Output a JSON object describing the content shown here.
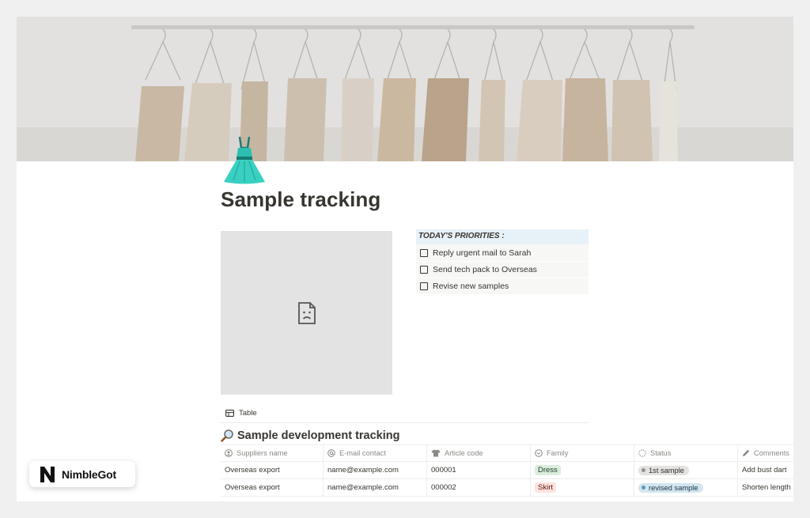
{
  "page": {
    "title": "Sample tracking",
    "icon": "dress-emoji-icon"
  },
  "priorities": {
    "header": "TODAY'S PRIORITIES :",
    "items": [
      {
        "label": "Reply urgent mail to Sarah",
        "checked": false
      },
      {
        "label": "Send tech pack to Overseas",
        "checked": false
      },
      {
        "label": "Revise new samples",
        "checked": false
      }
    ]
  },
  "database": {
    "view_label": "Table",
    "title": "Sample development tracking",
    "title_icon": "magnifier-icon",
    "columns": [
      {
        "label": "Suppliers name",
        "icon": "person-icon"
      },
      {
        "label": "E-mail contact",
        "icon": "at-sign-icon"
      },
      {
        "label": "Article code",
        "icon": "shirt-icon"
      },
      {
        "label": "Family",
        "icon": "select-icon"
      },
      {
        "label": "Status",
        "icon": "status-icon"
      },
      {
        "label": "Comments",
        "icon": "pencil-icon"
      }
    ],
    "rows": [
      {
        "supplier": "Overseas export",
        "email": "name@example.com",
        "code": "000001",
        "family": "Dress",
        "status": "1st sample",
        "comments": "Add bust dart"
      },
      {
        "supplier": "Overseas export",
        "email": "name@example.com",
        "code": "000002",
        "family": "Skirt",
        "status": "revised sample",
        "comments": "Shorten length"
      }
    ]
  },
  "colors": {
    "accent_header_bg": "#e7f1f8",
    "tag_dress_bg": "#dbeddb",
    "tag_skirt_bg": "#ffe2dd",
    "status_first_bg": "#e3e2e0",
    "status_revised_bg": "#d3e5ef"
  },
  "badge": {
    "brand": "NimbleGot"
  }
}
